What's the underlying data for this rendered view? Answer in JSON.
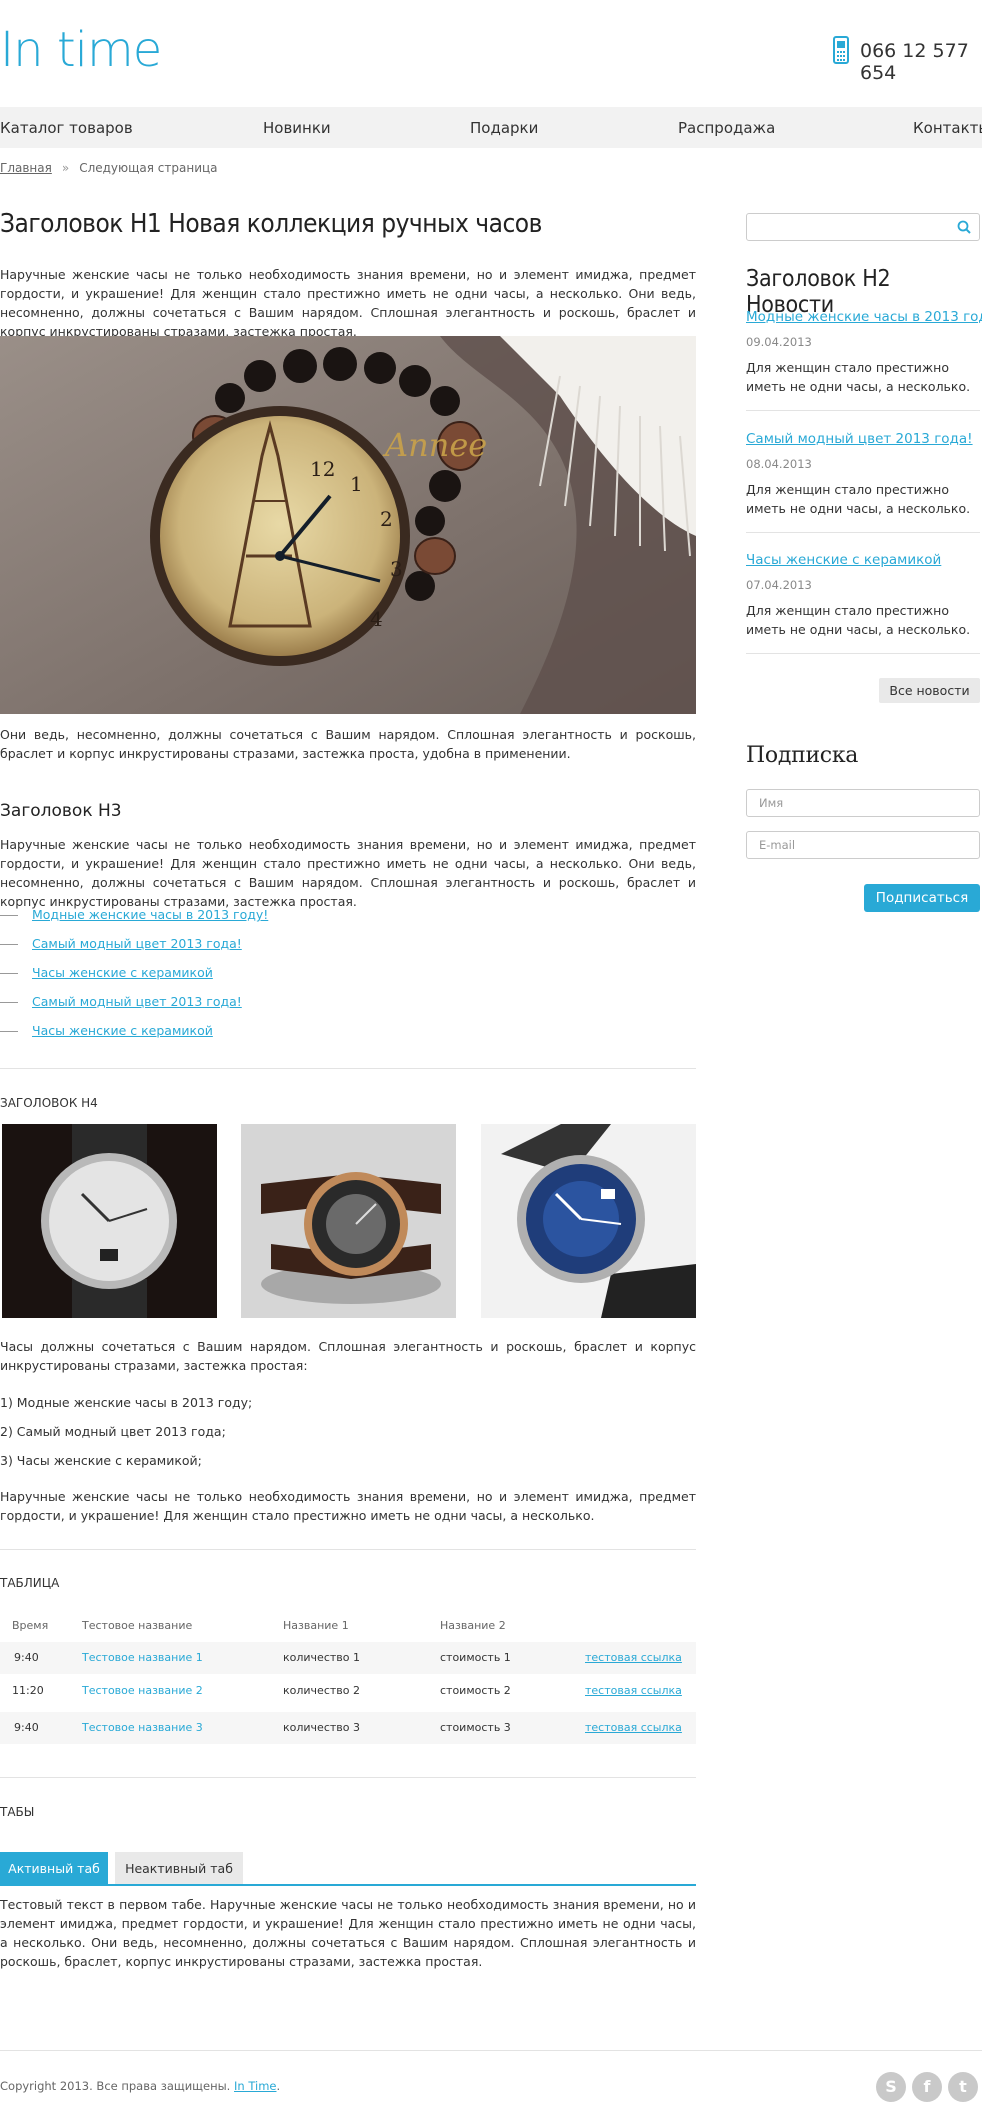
{
  "header": {
    "logo": "In time",
    "phone": "066 12 577 654"
  },
  "nav": {
    "items": [
      "Каталог товаров",
      "Новинки",
      "Подарки",
      "Распродажа",
      "Контакты"
    ]
  },
  "breadcrumb": {
    "home": "Главная",
    "separator": "»",
    "current": "Следующая страница"
  },
  "main": {
    "h1": "Заголовок H1 Новая коллекция ручных часов",
    "intro": "Наручные женские часы не только необходимость знания времени, но и элемент имиджа, предмет гордости, и украшение! Для женщин стало престижно иметь не одни часы, а несколько. Они ведь, несомненно, должны сочетаться с Вашим нарядом. Сплошная элегантность и роскошь, браслет и корпус инкрустированы стразами, застежка простая.",
    "hero_signature": "Annee",
    "caption": "Они ведь, несомненно, должны сочетаться с Вашим нарядом. Сплошная элегантность и роскошь, браслет и корпус инкрустированы стразами, застежка проста, удобна в применении.",
    "h3": "Заголовок H3",
    "h3_text": "Наручные женские часы не только необходимость знания времени, но и элемент имиджа, предмет гордости, и украшение! Для женщин стало престижно иметь не одни часы, а несколько. Они ведь, несомненно, должны сочетаться с Вашим нарядом. Сплошная элегантность и роскошь, браслет и корпус инкрустированы стразами, застежка простая.",
    "links": [
      "Модные женские часы в 2013 году!",
      "Самый модный цвет 2013 года!",
      "Часы женские с керамикой",
      "Самый модный цвет 2013 года!",
      "Часы женские с керамикой"
    ],
    "h4": "Заголовок H4",
    "h4_text": "Часы должны сочетаться с Вашим нарядом. Сплошная элегантность и роскошь, браслет и корпус инкрустированы стразами, застежка простая:",
    "numbered": [
      "1) Модные женские часы в 2013 году;",
      "2) Самый модный цвет 2013 года;",
      "3) Часы женские с керамикой;"
    ],
    "closing": "Наручные женские часы не только необходимость знания времени, но и элемент имиджа, предмет гордости, и украшение! Для женщин стало престижно иметь не одни часы, а несколько.",
    "table_heading": "Таблица",
    "table": {
      "headers": [
        "Время",
        "Тестовое название",
        "Название 1",
        "Название 2"
      ],
      "rows": [
        [
          "9:40",
          "Тестовое название 1",
          "количество 1",
          "стоимость 1",
          "тестовая ссылка"
        ],
        [
          "11:20",
          "Тестовое название 2",
          "количество 2",
          "стоимость 2",
          "тестовая ссылка"
        ],
        [
          "9:40",
          "Тестовое название 3",
          "количество 3",
          "стоимость 3",
          "тестовая ссылка"
        ]
      ]
    },
    "tabs_heading": "Табы",
    "tabs": [
      "Активный таб",
      "Неактивный таб"
    ],
    "tab_text": "Тестовый текст в первом табе. Наручные женские часы не только необходимость знания времени, но и элемент имиджа, предмет гордости, и украшение! Для женщин стало престижно иметь не одни часы, а несколько. Они ведь, несомненно, должны сочетаться с Вашим нарядом. Сплошная элегантность и роскошь, браслет, корпус инкрустированы стразами, застежка простая."
  },
  "sidebar": {
    "search_placeholder": "",
    "news_heading": "Заголовок H2 Новости",
    "news": [
      {
        "title": "Модные женские часы в 2013 году!",
        "date": "09.04.2013",
        "text": "Для женщин стало престижно иметь не одни часы, а несколько."
      },
      {
        "title": "Самый модный цвет 2013 года!",
        "date": "08.04.2013",
        "text": "Для женщин стало престижно иметь не одни часы, а несколько."
      },
      {
        "title": "Часы женские с керамикой",
        "date": "07.04.2013",
        "text": "Для женщин стало престижно иметь не одни часы, а несколько."
      }
    ],
    "all_news": "Все новости",
    "subscribe_heading": "Подписка",
    "name_placeholder": "Имя",
    "email_placeholder": "E-mail",
    "subscribe_button": "Подписаться"
  },
  "footer": {
    "copyright": "Copyright 2013. Все права защищены.",
    "brand_link": "In Time",
    "copyright_end": ".",
    "social": [
      "skype-icon",
      "facebook-icon",
      "twitter-icon"
    ]
  },
  "colors": {
    "accent": "#29a9d6",
    "nav_bg": "#f2f2f2"
  }
}
